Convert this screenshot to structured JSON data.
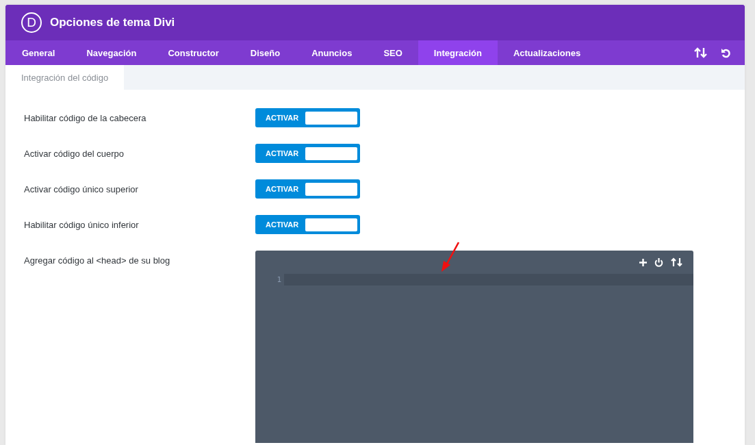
{
  "header": {
    "logo_letter": "D",
    "title": "Opciones de tema Divi"
  },
  "tabs": [
    {
      "label": "General",
      "selected": false
    },
    {
      "label": "Navegación",
      "selected": false
    },
    {
      "label": "Constructor",
      "selected": false
    },
    {
      "label": "Diseño",
      "selected": false
    },
    {
      "label": "Anuncios",
      "selected": false
    },
    {
      "label": "SEO",
      "selected": false
    },
    {
      "label": "Integración",
      "selected": true
    },
    {
      "label": "Actualizaciones",
      "selected": false
    }
  ],
  "subtabs": [
    {
      "label": "Integración del código",
      "selected": true
    }
  ],
  "settings": [
    {
      "kind": "toggle",
      "label": "Habilitar código de la cabecera",
      "toggle_label": "ACTIVAR",
      "on": true
    },
    {
      "kind": "toggle",
      "label": "Activar código del cuerpo",
      "toggle_label": "ACTIVAR",
      "on": true
    },
    {
      "kind": "toggle",
      "label": "Activar código único superior",
      "toggle_label": "ACTIVAR",
      "on": true
    },
    {
      "kind": "toggle",
      "label": "Habilitar código único inferior",
      "toggle_label": "ACTIVAR",
      "on": true
    },
    {
      "kind": "code",
      "label": "Agregar código al <head> de su blog",
      "line_numbers": [
        "1"
      ]
    }
  ]
}
